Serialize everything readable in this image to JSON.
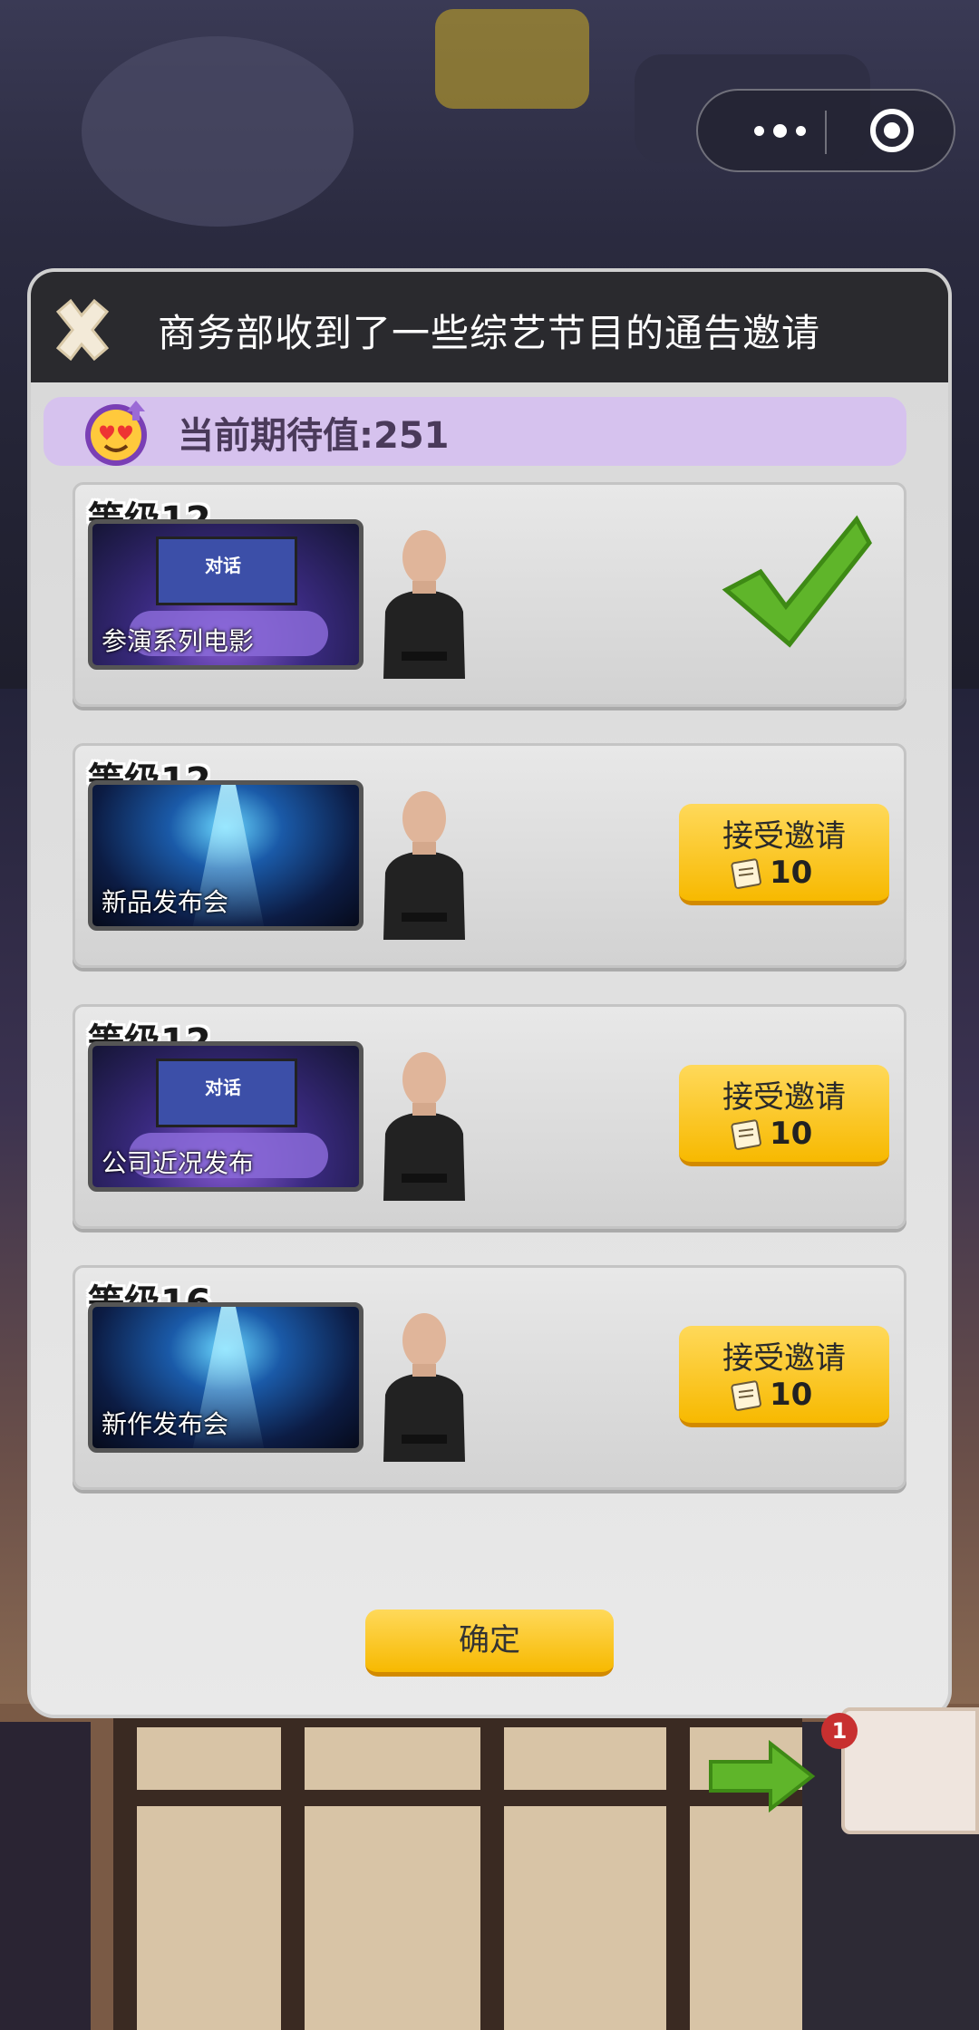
{
  "dialog": {
    "title": "商务部收到了一些综艺节目的通告邀请",
    "expectation_label": "当前期待值:251",
    "confirm_label": "确定"
  },
  "invitations": [
    {
      "level": "等级12",
      "event": "参演系列电影",
      "thumb_text": "对话",
      "status": "accepted"
    },
    {
      "level": "等级12",
      "event": "新品发布会",
      "accept_label": "接受邀请",
      "cost": "10"
    },
    {
      "level": "等级12",
      "event": "公司近况发布",
      "thumb_text": "对话",
      "accept_label": "接受邀请",
      "cost": "10"
    },
    {
      "level": "等级16",
      "event": "新作发布会",
      "accept_label": "接受邀请",
      "cost": "10"
    }
  ],
  "notification": {
    "badge_count": "1"
  },
  "icons": {
    "close": "close-x-icon",
    "expectation": "heart-eyes-emoji-icon",
    "accepted": "green-checkmark-icon",
    "cost": "work-ticket-icon",
    "menu": "more-dots-icon",
    "exit": "target-circle-icon",
    "next": "green-arrow-icon"
  },
  "colors": {
    "accent_button": "#f7b900",
    "header_bg": "#2a2a2e",
    "expect_bar": "#d6c2ee",
    "check_green": "#5fb52a"
  }
}
